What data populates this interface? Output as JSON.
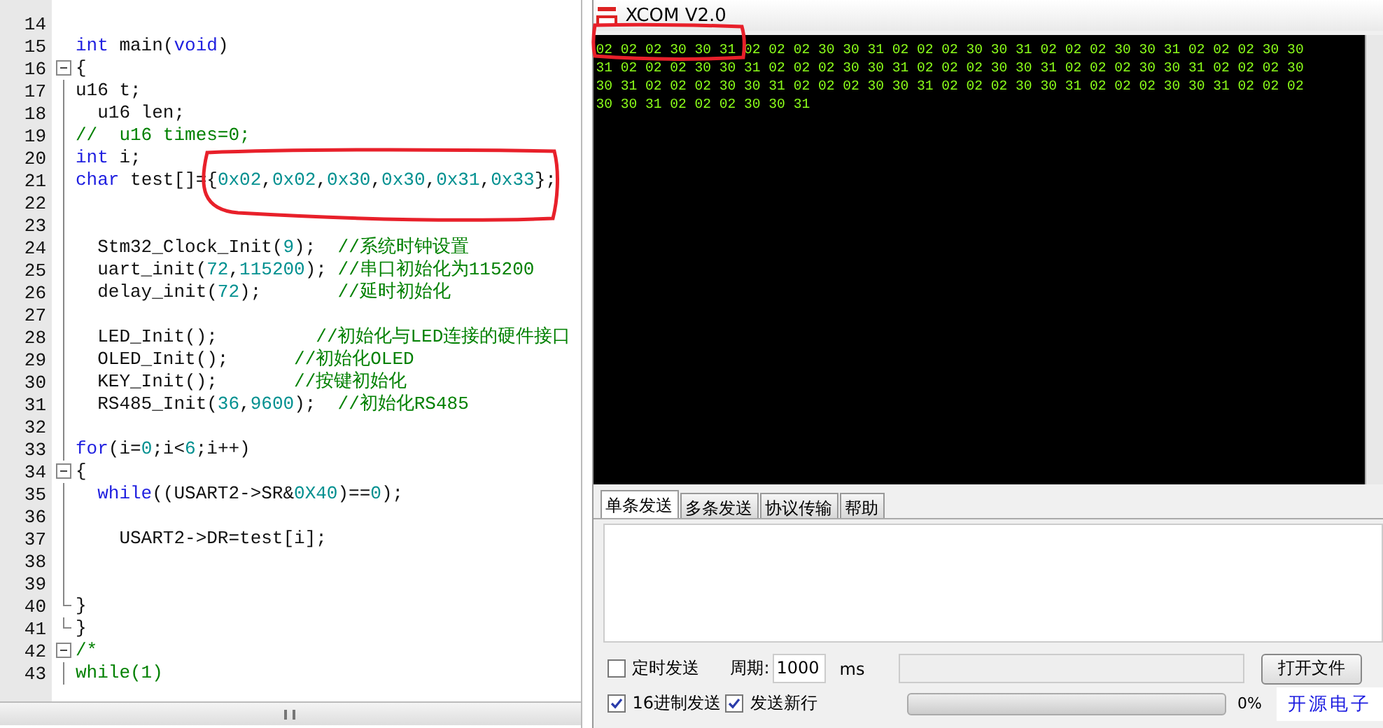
{
  "editor": {
    "lines": [
      {
        "number": "14",
        "kind": "plain"
      },
      {
        "number": "15",
        "kind": "plain",
        "segments": [
          {
            "kind": "keyword",
            "text": "int"
          },
          {
            "kind": "plain",
            "text": " main("
          },
          {
            "kind": "keyword",
            "text": "void"
          },
          {
            "kind": "plain",
            "text": ")"
          }
        ]
      },
      {
        "number": "16",
        "kind": "foldstart",
        "segments": [
          {
            "kind": "plain",
            "text": "{"
          }
        ]
      },
      {
        "number": "17",
        "kind": "body",
        "segments": [
          {
            "kind": "plain",
            "text": "u16 t;"
          }
        ]
      },
      {
        "number": "18",
        "kind": "body",
        "segments": [
          {
            "kind": "plain",
            "text": "  u16 len;"
          }
        ]
      },
      {
        "number": "19",
        "kind": "body",
        "segments": [
          {
            "kind": "comment",
            "text": "//  u16 times=0;"
          }
        ]
      },
      {
        "number": "20",
        "kind": "body",
        "segments": [
          {
            "kind": "keyword",
            "text": "int"
          },
          {
            "kind": "plain",
            "text": " i;"
          }
        ]
      },
      {
        "number": "21",
        "kind": "body",
        "segments": [
          {
            "kind": "keyword",
            "text": "char"
          },
          {
            "kind": "plain",
            "text": " test[]="
          },
          {
            "kind": "plain",
            "text": "{"
          },
          {
            "kind": "number",
            "text": "0x02"
          },
          {
            "kind": "plain",
            "text": ","
          },
          {
            "kind": "number",
            "text": "0x02"
          },
          {
            "kind": "plain",
            "text": ","
          },
          {
            "kind": "number",
            "text": "0x30"
          },
          {
            "kind": "plain",
            "text": ","
          },
          {
            "kind": "number",
            "text": "0x30"
          },
          {
            "kind": "plain",
            "text": ","
          },
          {
            "kind": "number",
            "text": "0x31"
          },
          {
            "kind": "plain",
            "text": ","
          },
          {
            "kind": "number",
            "text": "0x33"
          },
          {
            "kind": "plain",
            "text": "};"
          }
        ]
      },
      {
        "number": "22",
        "kind": "body"
      },
      {
        "number": "23",
        "kind": "body"
      },
      {
        "number": "24",
        "kind": "body",
        "segments": [
          {
            "kind": "plain",
            "text": "  Stm32_Clock_Init("
          },
          {
            "kind": "number",
            "text": "9"
          },
          {
            "kind": "plain",
            "text": ");  "
          },
          {
            "kind": "comment",
            "text": "//系统时钟设置"
          }
        ]
      },
      {
        "number": "25",
        "kind": "body",
        "segments": [
          {
            "kind": "plain",
            "text": "  uart_init("
          },
          {
            "kind": "number",
            "text": "72"
          },
          {
            "kind": "plain",
            "text": ","
          },
          {
            "kind": "number",
            "text": "115200"
          },
          {
            "kind": "plain",
            "text": "); "
          },
          {
            "kind": "comment",
            "text": "//串口初始化为115200"
          }
        ]
      },
      {
        "number": "26",
        "kind": "body",
        "segments": [
          {
            "kind": "plain",
            "text": "  delay_init("
          },
          {
            "kind": "number",
            "text": "72"
          },
          {
            "kind": "plain",
            "text": ");       "
          },
          {
            "kind": "comment",
            "text": "//延时初始化"
          }
        ]
      },
      {
        "number": "27",
        "kind": "body"
      },
      {
        "number": "28",
        "kind": "body",
        "segments": [
          {
            "kind": "plain",
            "text": "  LED_Init();         "
          },
          {
            "kind": "comment",
            "text": "//初始化与LED连接的硬件接口"
          }
        ]
      },
      {
        "number": "29",
        "kind": "body",
        "segments": [
          {
            "kind": "plain",
            "text": "  OLED_Init();      "
          },
          {
            "kind": "comment",
            "text": "//初始化OLED"
          }
        ]
      },
      {
        "number": "30",
        "kind": "body",
        "segments": [
          {
            "kind": "plain",
            "text": "  KEY_Init();       "
          },
          {
            "kind": "comment",
            "text": "//按键初始化"
          }
        ]
      },
      {
        "number": "31",
        "kind": "body",
        "segments": [
          {
            "kind": "plain",
            "text": "  RS485_Init("
          },
          {
            "kind": "number",
            "text": "36"
          },
          {
            "kind": "plain",
            "text": ","
          },
          {
            "kind": "number",
            "text": "9600"
          },
          {
            "kind": "plain",
            "text": ");  "
          },
          {
            "kind": "comment",
            "text": "//初始化RS485"
          }
        ]
      },
      {
        "number": "32",
        "kind": "body"
      },
      {
        "number": "33",
        "kind": "body",
        "segments": [
          {
            "kind": "keyword",
            "text": "for"
          },
          {
            "kind": "plain",
            "text": "(i="
          },
          {
            "kind": "number",
            "text": "0"
          },
          {
            "kind": "plain",
            "text": ";i<"
          },
          {
            "kind": "number",
            "text": "6"
          },
          {
            "kind": "plain",
            "text": ";i++)"
          }
        ]
      },
      {
        "number": "34",
        "kind": "foldstart",
        "segments": [
          {
            "kind": "plain",
            "text": "{"
          }
        ]
      },
      {
        "number": "35",
        "kind": "body",
        "segments": [
          {
            "kind": "keyword",
            "text": "  while"
          },
          {
            "kind": "plain",
            "text": "((USART2->SR&"
          },
          {
            "kind": "number",
            "text": "0X40"
          },
          {
            "kind": "plain",
            "text": ")=="
          },
          {
            "kind": "number",
            "text": "0"
          },
          {
            "kind": "plain",
            "text": ");"
          }
        ]
      },
      {
        "number": "36",
        "kind": "body"
      },
      {
        "number": "37",
        "kind": "body",
        "segments": [
          {
            "kind": "plain",
            "text": "    USART2->DR=test[i];"
          }
        ]
      },
      {
        "number": "38",
        "kind": "body"
      },
      {
        "number": "39",
        "kind": "body"
      },
      {
        "number": "40",
        "kind": "foldend",
        "segments": [
          {
            "kind": "plain",
            "text": "}"
          }
        ]
      },
      {
        "number": "41",
        "kind": "foldend",
        "segments": [
          {
            "kind": "plain",
            "text": "}"
          }
        ]
      },
      {
        "number": "42",
        "kind": "foldstart",
        "segments": [
          {
            "kind": "comment",
            "text": "/*"
          }
        ]
      },
      {
        "number": "43",
        "kind": "body",
        "segments": [
          {
            "kind": "comment",
            "text": "while(1)"
          }
        ]
      }
    ]
  },
  "xcom": {
    "title": "XCOM V2.0",
    "received_lines": [
      "02 02 02 30 30 31 02 02 02 30 30 31 02 02 02 30 30 31 02 02 02 30 30 31 02 02 02 30 30",
      "31 02 02 02 30 30 31 02 02 02 30 30 31 02 02 02 30 30 31 02 02 02 30 30 31 02 02 02 30",
      "30 31 02 02 02 30 30 31 02 02 02 30 30 31 02 02 02 30 30 31 02 02 02 30 30 31 02 02 02",
      "30 30 31 02 02 02 30 30 31"
    ],
    "tabs": [
      {
        "label": "单条发送",
        "selected": true
      },
      {
        "label": "多条发送",
        "selected": false
      },
      {
        "label": "协议传输",
        "selected": false
      },
      {
        "label": "帮助",
        "selected": false
      }
    ],
    "timed_send": {
      "label": "定时发送",
      "checked": false
    },
    "period_label": "周期:",
    "period_value": "1000",
    "period_unit": "ms",
    "open_file_button": "打开文件",
    "hex_send": {
      "label": "16进制发送",
      "checked": true
    },
    "send_newline": {
      "label": "发送新行",
      "checked": true
    },
    "progress": {
      "level": 0,
      "reading": "0%"
    },
    "brand": "开源电子"
  }
}
